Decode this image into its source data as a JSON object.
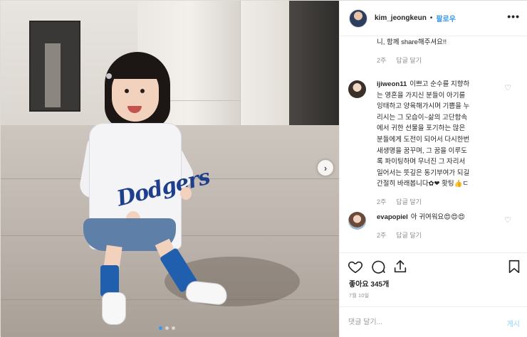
{
  "header": {
    "username": "kim_jeongkeun",
    "separator": "•",
    "follow_label": "팔로우",
    "more_icon": "more-icon"
  },
  "comments": {
    "first": {
      "text_tail": "니, 함께 share해주셔요!!",
      "age": "2주",
      "reply": "답글 달기"
    },
    "items": [
      {
        "username": "ijiweon11",
        "lines": [
          "이쁘고 순수를 지향하",
          "는 영혼을 가지신 분들이 아기를",
          "잉태하고 양육해가시며 기쁨을 누",
          "리시는 그 모습이~삶의 고단함속",
          "에서 귀한 선물을 포기하는 많은",
          "분들에게 도전이 되어서 다시한번",
          "새생명을 꿈꾸며, 그 꿈을 이루도",
          "록 파이팅하며 무너진 그 자리서",
          "일어서는 뜻깊은 동기부여가 되길",
          "간절히 바래봅니다✿❤ 홧팅👍ㄷ"
        ],
        "age": "2주",
        "reply": "답글 달기"
      },
      {
        "username": "evapopiel",
        "text": "아 귀여워요😍😍😍",
        "age": "2주",
        "reply": "답글 달기"
      }
    ]
  },
  "actions": {
    "like_icon": "heart-icon",
    "comment_icon": "comment-icon",
    "share_icon": "share-icon",
    "save_icon": "bookmark-icon"
  },
  "likes": "좋아요 345개",
  "date": "7월 10일",
  "comment_box": {
    "placeholder": "댓글 달기...",
    "post_label": "게시"
  },
  "colors": {
    "accent": "#3897f0",
    "muted": "#8e8e8e",
    "post_disabled": "#b2dffc"
  },
  "carousel": {
    "next_icon": "chevron-right-icon",
    "slide_count": 3,
    "active_index": 0
  }
}
